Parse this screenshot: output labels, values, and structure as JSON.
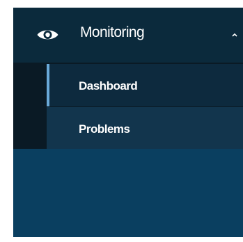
{
  "menu": {
    "title": "Monitoring",
    "icon": "eye-icon",
    "expanded_icon": "chevron-up-icon",
    "items": [
      {
        "label": "Dashboard",
        "active": true
      },
      {
        "label": "Problems",
        "active": false
      }
    ]
  },
  "colors": {
    "sidebar_background": "#0a3f60",
    "header_background": "#0b2a3c",
    "active_indicator": "#6aa9d8",
    "text": "#ffffff"
  }
}
